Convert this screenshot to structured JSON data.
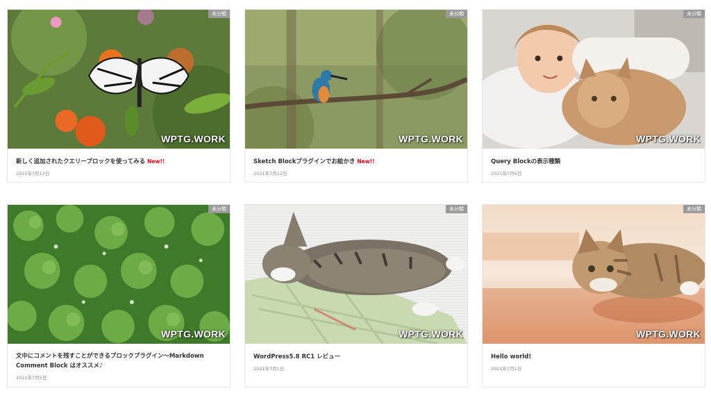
{
  "posts": [
    {
      "title": "新しく追加されたクエリーブロックを使ってみる",
      "new_label": "New!!",
      "date": "2021年7月12日",
      "category": "未分類",
      "watermark": "WPTG.WORK",
      "image": "butterfly-on-flowers"
    },
    {
      "title": "Sketch Blockプラグインでお絵かき",
      "new_label": "New!!",
      "date": "2021年7月12日",
      "category": "未分類",
      "watermark": "WPTG.WORK",
      "image": "kingfisher-on-branch"
    },
    {
      "title": "Query Blockの表示種類",
      "new_label": "",
      "date": "2021年7月6日",
      "category": "未分類",
      "watermark": "WPTG.WORK",
      "image": "girl-with-cat"
    },
    {
      "title": "文中にコメントを残すことができるブロックプラグイン〜Markdown Comment Block はオススメ♪",
      "new_label": "",
      "date": "2021年7月5日",
      "category": "未分類",
      "watermark": "WPTG.WORK",
      "image": "clover-with-dew"
    },
    {
      "title": "WordPress5.8 RC1 レビュー",
      "new_label": "",
      "date": "2021年7月1日",
      "category": "未分類",
      "watermark": "WPTG.WORK",
      "image": "cat-sleeping-on-cushion"
    },
    {
      "title": "Hello world!",
      "new_label": "",
      "date": "2021年7月1日",
      "category": "未分類",
      "watermark": "WPTG.WORK",
      "image": "cat-on-table"
    }
  ],
  "colors": {
    "new_label": "#e60012",
    "badge_bg": "#9a9a9a",
    "title_text": "#333333",
    "date_text": "#888888"
  }
}
